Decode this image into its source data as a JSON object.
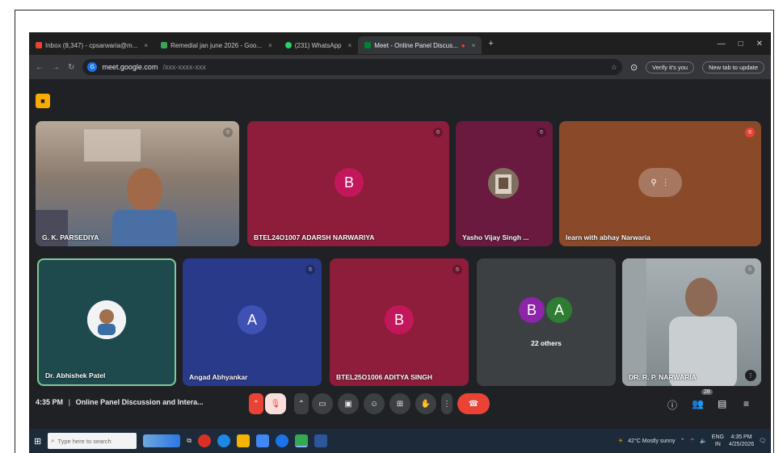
{
  "browser": {
    "tabs": [
      {
        "label": "Inbox (8,347) - cpsarwaria@m...",
        "color": "#ea4335"
      },
      {
        "label": "Remedial jan june 2026 - Goo...",
        "color": "#34a853"
      },
      {
        "label": "(231) WhatsApp",
        "color": "#25d366"
      },
      {
        "label": "Meet - Online Panel Discus...",
        "color": "#00832d",
        "active": true
      }
    ],
    "new_tab": "+",
    "url_host": "meet.google.com",
    "url_path": "/xxx-xxxx-xxx",
    "verify_label": "Verify it's you",
    "update_label": "New tab to update"
  },
  "meet": {
    "participants": [
      {
        "name": "G. K. PARSEDIYA",
        "type": "video",
        "bg": "#6b6560"
      },
      {
        "name": "BTEL24O1007 ADARSH NARWARIYA",
        "initial": "B",
        "bg": "#8e1c3b",
        "avatar": "#c2185b"
      },
      {
        "name": "Yasho Vijay Singh ...",
        "type": "image",
        "bg": "#6a1a3e"
      },
      {
        "name": "learn with abhay Narwaria",
        "type": "image",
        "bg": "#8a4a2a"
      },
      {
        "name": "Dr. Abhishek Patel",
        "type": "image",
        "bg": "#1e4a4d"
      },
      {
        "name": "Angad Abhyankar",
        "initial": "A",
        "bg": "#2a3a8a",
        "avatar": "#3f51b5"
      },
      {
        "name": "BTEL25O1006 ADITYA SINGH",
        "initial": "B",
        "bg": "#8e1c3b",
        "avatar": "#c2185b"
      },
      {
        "name": "22 others",
        "initials": [
          "B",
          "A"
        ],
        "bg": "#3c4043"
      },
      {
        "name": "DR. R. P. NARWARIA",
        "type": "video",
        "bg": "#8a8f92"
      }
    ],
    "time": "4:35 PM",
    "separator": "|",
    "meeting_title": "Online Panel Discussion and Intera...",
    "participant_count": "28"
  },
  "taskbar": {
    "search_placeholder": "Type here to search",
    "weather": "42°C  Mostly sunny",
    "lang": "ENG",
    "region": "IN",
    "clock_time": "4:35 PM",
    "clock_date": "4/25/2026"
  }
}
